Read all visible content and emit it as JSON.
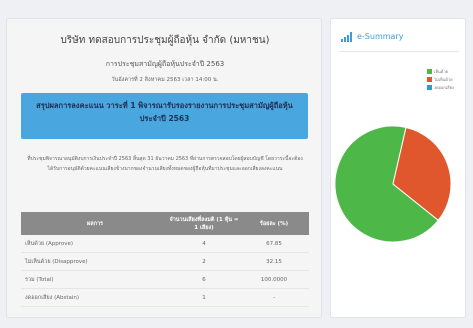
{
  "report": {
    "company_title": "บริษัท ทดสอบการประชุมผู้ถือหุ้น จำกัด (มหาชน)",
    "subtitle": "การประชุมสามัญผู้ถือหุ้นประจำปี 2563",
    "date_line": "วันอังคารที่ 2 สิงหาคม 2563 เวลา 14:00 น.",
    "summary_title": "สรุปผลการลงคะแนน วาระที่ 1 พิจารณารับรองรายงานการประชุมสามัญผู้ถือหุ้น ประจำปี 2563",
    "description": "ที่ประชุมพิจารณาอนุมัติงบการเงินประจำปี 2563 สิ้นสุด 31 ธันวาคม 2563 ที่ผ่านการตรวจสอบโดยผู้สอบบัญชี โดยวาระนี้จะต้องได้รับการอนุมัติด้วยคะแนนเสียงข้างมากของจำนวนเสียงทั้งหมดของผู้ถือหุ้นที่มาประชุมและออกเสียงลงคะแนน"
  },
  "table": {
    "headers": [
      "ผลการ",
      "จำนวนเสียงที่ลงมติ (1 หุ้น = 1 เสียง)",
      "ร้อยละ (%)"
    ],
    "rows": [
      {
        "label": "เห็นด้วย (Approve)",
        "votes": "4",
        "percent": "67.85"
      },
      {
        "label": "ไม่เห็นด้วย (Disapprove)",
        "votes": "2",
        "percent": "32.15"
      },
      {
        "label": "รวม (Total)",
        "votes": "6",
        "percent": "100.0000"
      },
      {
        "label": "งดออกเสียง (Abstain)",
        "votes": "1",
        "percent": "-"
      }
    ]
  },
  "summary_panel": {
    "title": "e-Summary",
    "icon": "bar-chart-icon"
  },
  "chart_data": {
    "type": "pie",
    "categories": [
      "เห็นด้วย",
      "ไม่เห็นด้วย",
      "งดออกเสียง"
    ],
    "values": [
      67.85,
      32.15,
      0
    ],
    "colors": [
      "#4db847",
      "#e0562d",
      "#2b9bd6"
    ],
    "legend_position": "top-right"
  }
}
